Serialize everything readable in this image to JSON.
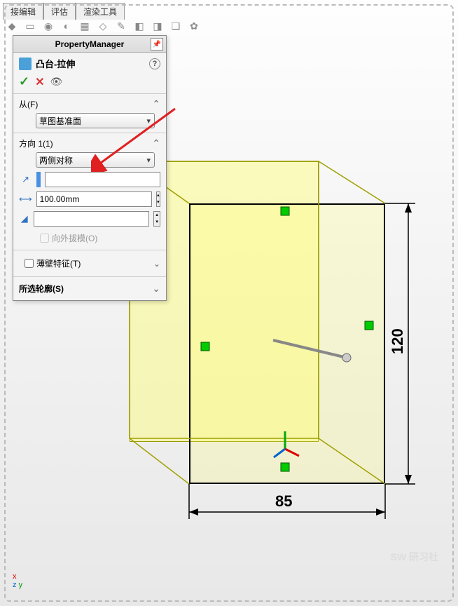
{
  "tabs": {
    "edit": "接编辑",
    "evaluate": "评估",
    "render": "渲染工具"
  },
  "panel": {
    "title": "PropertyManager",
    "feature_name": "凸台-拉伸",
    "help_icon": "?",
    "from": {
      "label": "从(F)",
      "value": "草图基准面"
    },
    "direction": {
      "label": "方向 1(1)",
      "end_condition": "两侧对称",
      "depth_value": "100.00mm",
      "draft_label": "向外拔模(O)"
    },
    "thin": {
      "label": "薄壁特征(T)"
    },
    "contours": {
      "label": "所选轮廓(S)"
    }
  },
  "dimensions": {
    "width": "85",
    "height": "120"
  },
  "watermark": "SW\n研习社"
}
